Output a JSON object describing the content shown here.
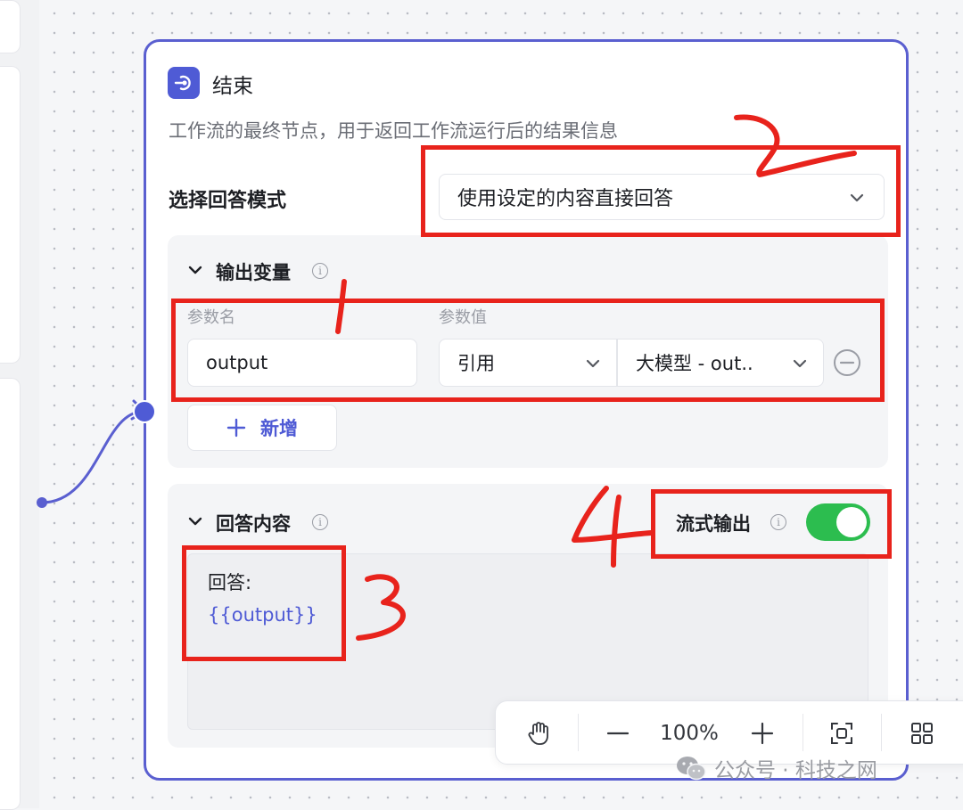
{
  "node": {
    "title": "结束",
    "description": "工作流的最终节点，用于返回工作流运行后的结果信息",
    "answer_mode_label": "选择回答模式",
    "answer_mode_value": "使用设定的内容直接回答"
  },
  "output_vars": {
    "title": "输出变量",
    "param_name_label": "参数名",
    "param_value_label": "参数值",
    "rows": [
      {
        "name": "output",
        "type": "引用",
        "source": "大模型 - out.."
      }
    ],
    "add_label": "新增"
  },
  "answer": {
    "title": "回答内容",
    "stream_label": "流式输出",
    "stream_enabled": true,
    "content_line1": "回答:",
    "content_line2": "{{output}}"
  },
  "toolbar": {
    "zoom": "100%"
  },
  "watermark": "公众号 · 科技之网",
  "colors": {
    "accent": "#4f5bd5",
    "toggle_on": "#2cbd4f",
    "annotation_red": "#e8231c"
  }
}
